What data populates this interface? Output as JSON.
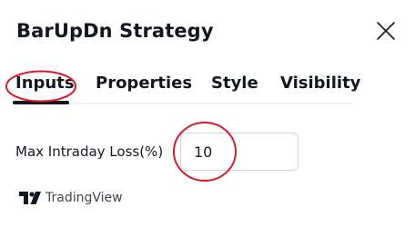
{
  "dialog": {
    "title": "BarUpDn Strategy",
    "close_icon": "close-icon"
  },
  "tabs": [
    {
      "label": "Inputs",
      "active": true
    },
    {
      "label": "Properties",
      "active": false
    },
    {
      "label": "Style",
      "active": false
    },
    {
      "label": "Visibility",
      "active": false
    }
  ],
  "inputs": {
    "max_intraday_loss": {
      "label": "Max Intraday Loss(%)",
      "value": "10"
    }
  },
  "footer": {
    "brand_icon": "tradingview-logo-icon",
    "brand_text": "TradingView"
  },
  "colors": {
    "text": "#131722",
    "annotation": "#d81b2a",
    "input_border": "#d1d4dc"
  }
}
